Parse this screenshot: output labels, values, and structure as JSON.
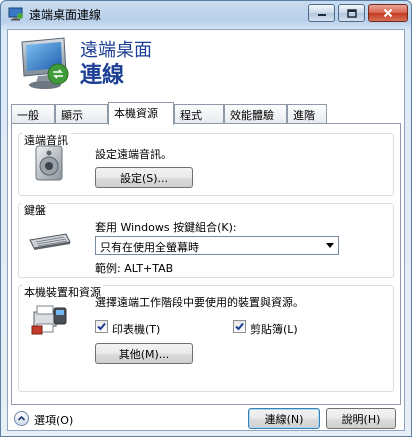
{
  "window": {
    "title": "遠端桌面連線",
    "header_line1": "遠端桌面",
    "header_line2": "連線"
  },
  "tabs": [
    {
      "label": "一般",
      "active": false
    },
    {
      "label": "顯示",
      "active": false
    },
    {
      "label": "本機資源",
      "active": true
    },
    {
      "label": "程式",
      "active": false
    },
    {
      "label": "效能體驗",
      "active": false
    },
    {
      "label": "進階",
      "active": false
    }
  ],
  "audio": {
    "group_label": "遠端音訊",
    "description": "設定遠端音訊。",
    "settings_button": "設定(S)..."
  },
  "keyboard": {
    "group_label": "鍵盤",
    "description": "套用 Windows 按鍵組合(K):",
    "selected_option": "只有在使用全螢幕時",
    "example": "範例: ALT+TAB"
  },
  "local_devices": {
    "group_label": "本機裝置和資源",
    "description": "選擇遠端工作階段中要使用的裝置與資源。",
    "printers_label": "印表機(T)",
    "printers_checked": true,
    "clipboard_label": "剪貼簿(L)",
    "clipboard_checked": true,
    "more_button": "其他(M)..."
  },
  "footer": {
    "options_label": "選項(O)",
    "connect_button": "連線(N)",
    "help_button": "說明(H)"
  }
}
